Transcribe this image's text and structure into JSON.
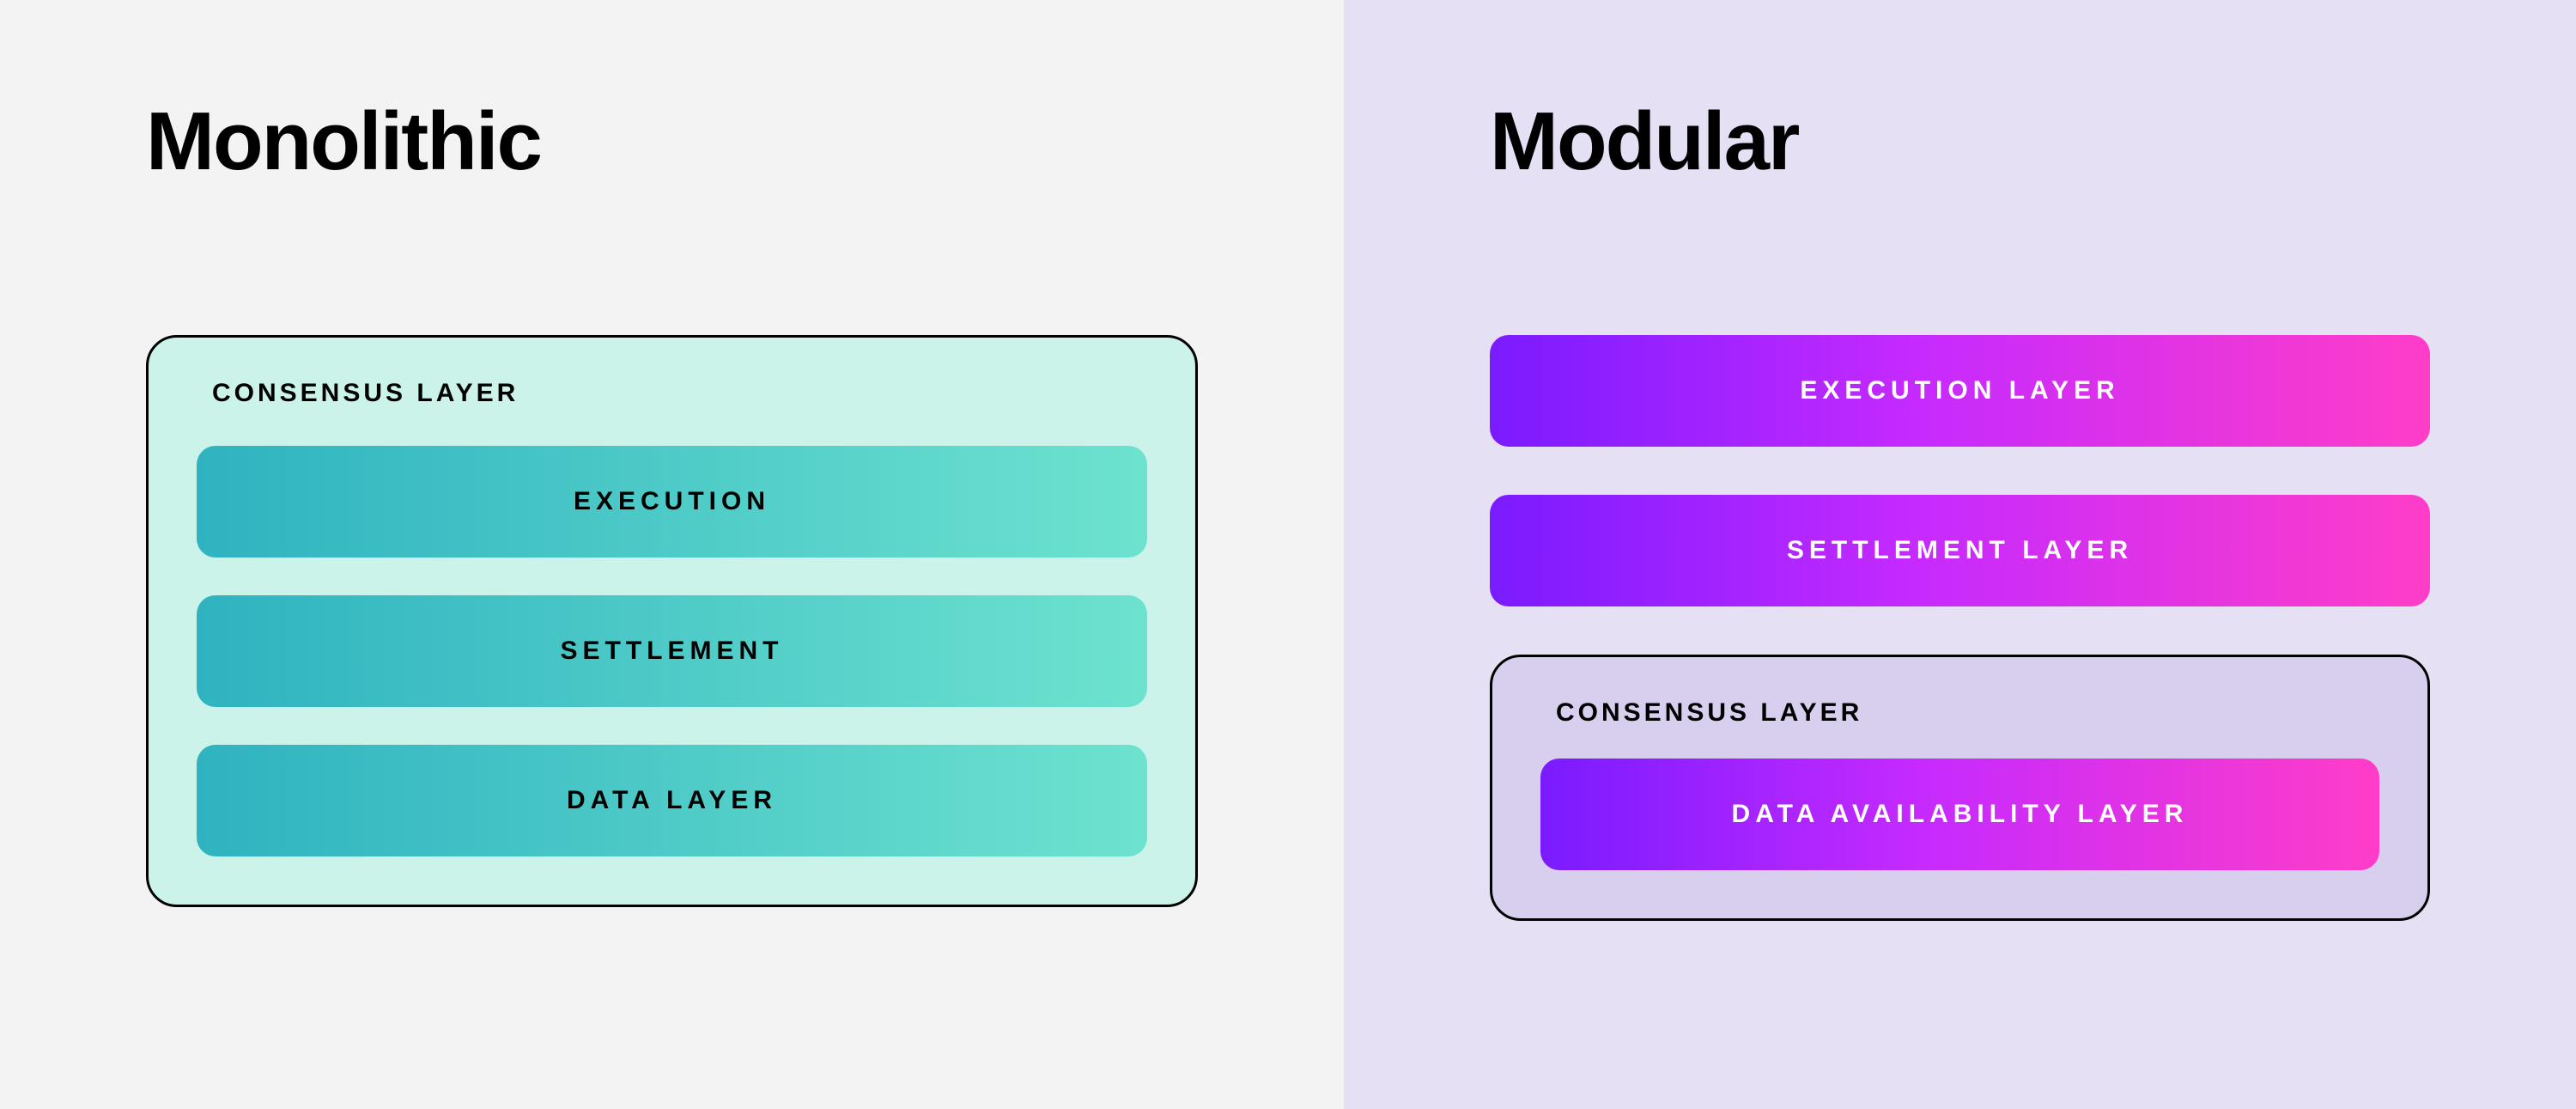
{
  "left": {
    "title": "Monolithic",
    "consensus_label": "CONSENSUS LAYER",
    "bars": [
      "EXECUTION",
      "SETTLEMENT",
      "DATA LAYER"
    ]
  },
  "right": {
    "title": "Modular",
    "bars_top": [
      "EXECUTION  LAYER",
      "SETTLEMENT LAYER"
    ],
    "consensus_label": "CONSENSUS LAYER",
    "bars_inner": [
      "DATA AVAILABILITY LAYER"
    ]
  },
  "colors": {
    "bg_left": "#f3f3f3",
    "bg_right": "#e6e0f5",
    "consensus_left": "#cbf3e9",
    "consensus_right": "#d8cfee",
    "teal_grad": [
      "#2fb3c0",
      "#6de2cf"
    ],
    "mag_grad": [
      "#7a1bff",
      "#c52aff",
      "#ff3dc8"
    ]
  }
}
